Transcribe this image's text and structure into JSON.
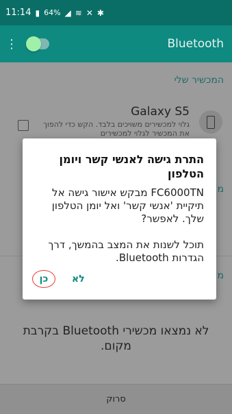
{
  "status_bar": {
    "time": "11:14",
    "battery": "64%",
    "icons": [
      "battery-icon",
      "signal-icon",
      "wifi-icon",
      "mute-icon",
      "bluetooth-icon"
    ]
  },
  "app_bar": {
    "title": "Bluetooth",
    "menu_icon": "more-vert-icon",
    "toggle_state": "on"
  },
  "my_device": {
    "header": "המכשיר שלי",
    "name": "Galaxy S5",
    "description": "גלוי למכשירים משויכים בלבד. הקש כדי להפוך את המכשיר לגלוי למכשירים"
  },
  "sections": {
    "paired_header": "מ",
    "available_header": "מ"
  },
  "dialog": {
    "title": "התרת גישה לאנשי קשר ויומן הטלפון",
    "body_p1": "FC6000TN מבקש אישור גישה אל תיקיית 'אנשי קשר' ואל יומן הטלפון שלך. לאפשר?",
    "body_p2": "תוכל לשנות את המצב בהמשך, דרך הגדרות Bluetooth.",
    "button_no": "לא",
    "button_yes": "כן"
  },
  "empty_state": {
    "text": "לא נמצאו מכשירי Bluetooth בקרבת מקום."
  },
  "scan_button": {
    "label": "סרוק"
  },
  "colors": {
    "status_bar": "#0a6e66",
    "app_bar": "#0e8a80",
    "accent": "#0f8a80",
    "highlight": "#e53935"
  }
}
